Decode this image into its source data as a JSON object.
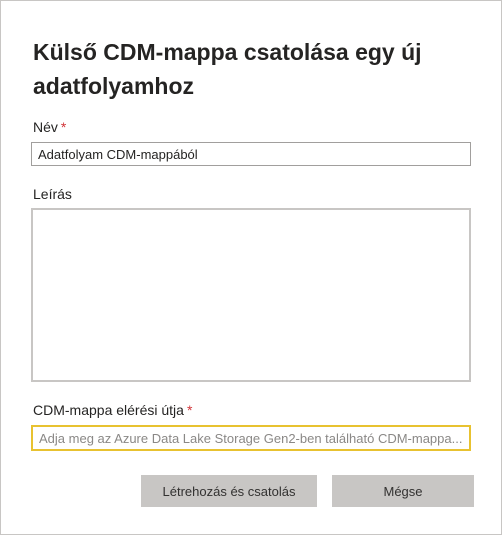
{
  "dialog": {
    "title": "Külső CDM-mappa csatolása egy új adatfolyamhoz"
  },
  "fields": {
    "name": {
      "label": "Név",
      "required": "*",
      "value": "Adatfolyam CDM-mappából"
    },
    "description": {
      "label": "Leírás",
      "value": ""
    },
    "cdm_path": {
      "label": "CDM-mappa elérési útja",
      "required": "*",
      "placeholder": "Adja meg az Azure Data Lake Storage Gen2-ben található CDM-mappa..."
    }
  },
  "buttons": {
    "create_attach": "Létrehozás és csatolás",
    "cancel": "Mégse"
  },
  "colors": {
    "required": "#d13438",
    "focus_border": "#e8c230",
    "button_bg": "#c8c6c4"
  }
}
